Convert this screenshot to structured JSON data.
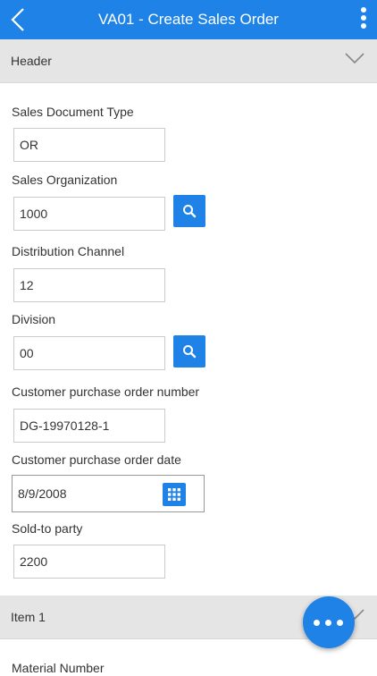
{
  "app": {
    "title": "VA01 - Create Sales Order",
    "back_icon": "chevron-left-icon",
    "more_icon": "more-vertical-icon"
  },
  "colors": {
    "accent": "#1e82e6",
    "section_bg": "#e5e5e5"
  },
  "header_section": {
    "label": "Header",
    "toggle_icon": "chevron-down-icon",
    "fields": {
      "sales_document_type": {
        "label": "Sales Document Type",
        "value": "OR"
      },
      "sales_organization": {
        "label": "Sales Organization",
        "value": "1000",
        "action_icon": "search-icon"
      },
      "distribution_channel": {
        "label": "Distribution Channel",
        "value": "12"
      },
      "division": {
        "label": "Division",
        "value": "00",
        "action_icon": "search-icon"
      },
      "customer_po_number": {
        "label": "Customer purchase order number",
        "value": "DG-19970128-1"
      },
      "customer_po_date": {
        "label": "Customer purchase order date",
        "value": "8/9/2008",
        "action_icon": "calendar-grid-icon"
      },
      "sold_to_party": {
        "label": "Sold-to party",
        "value": "2200"
      }
    }
  },
  "item_section": {
    "label": "Item 1",
    "toggle_icon": "chevron-down-icon",
    "next_label": "Material Number"
  },
  "fab": {
    "icon": "more-horizontal-icon"
  }
}
